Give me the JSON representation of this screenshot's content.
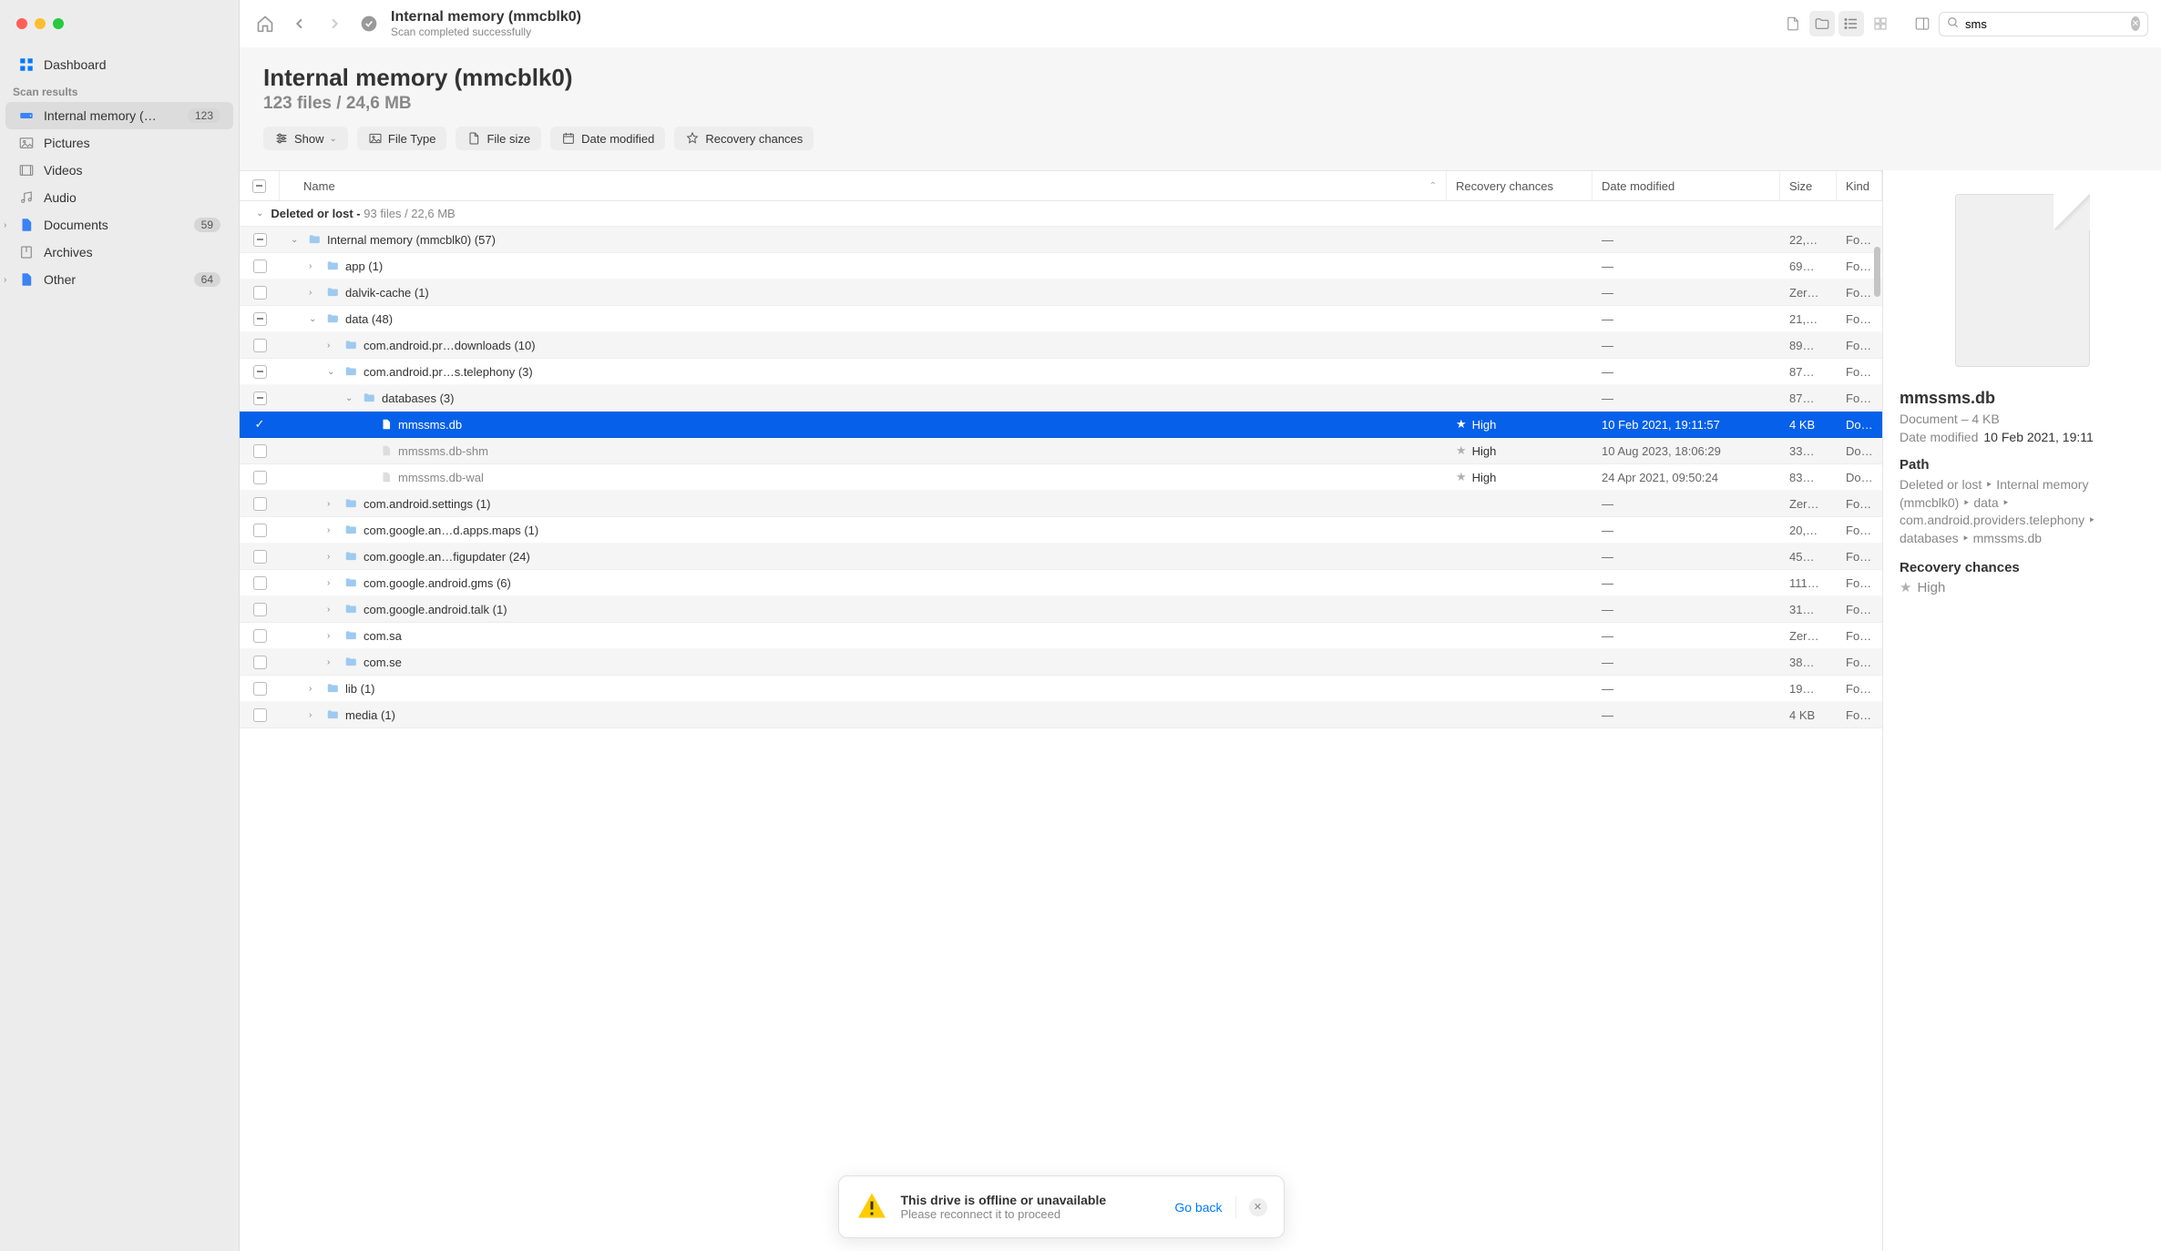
{
  "sidebar": {
    "dashboard": "Dashboard",
    "section": "Scan results",
    "items": [
      {
        "label": "Internal memory (…",
        "badge": "123",
        "active": true,
        "icon": "drive",
        "chev": false
      },
      {
        "label": "Pictures",
        "icon": "image",
        "chev": false
      },
      {
        "label": "Videos",
        "icon": "video",
        "chev": false
      },
      {
        "label": "Audio",
        "icon": "audio",
        "chev": false
      },
      {
        "label": "Documents",
        "badge": "59",
        "icon": "doc",
        "chev": true
      },
      {
        "label": "Archives",
        "icon": "archive",
        "chev": false
      },
      {
        "label": "Other",
        "badge": "64",
        "icon": "other",
        "chev": true
      }
    ]
  },
  "toolbar": {
    "title": "Internal memory (mmcblk0)",
    "subtitle": "Scan completed successfully",
    "search_value": "sms"
  },
  "header": {
    "title": "Internal memory (mmcblk0)",
    "subtitle": "123 files / 24,6 MB"
  },
  "filters": {
    "show": "Show",
    "filetype": "File Type",
    "filesize": "File size",
    "datemod": "Date modified",
    "recovery": "Recovery chances"
  },
  "columns": {
    "name": "Name",
    "recovery": "Recovery chances",
    "date": "Date modified",
    "size": "Size",
    "kind": "Kind"
  },
  "group": {
    "label": "Deleted or lost -",
    "meta": "93 files / 22,6 MB"
  },
  "rows": [
    {
      "indent": 0,
      "chev": "down",
      "cb": "part",
      "icon": "folder",
      "name": "Internal memory (mmcblk0) (57)",
      "rec": "",
      "date": "—",
      "size": "22,…",
      "kind": "Fol…"
    },
    {
      "indent": 1,
      "chev": "right",
      "cb": "",
      "icon": "folder",
      "name": "app (1)",
      "rec": "",
      "date": "—",
      "size": "69…",
      "kind": "Fol…"
    },
    {
      "indent": 1,
      "chev": "right",
      "cb": "",
      "icon": "folder",
      "name": "dalvik-cache (1)",
      "rec": "",
      "date": "—",
      "size": "Zer…",
      "kind": "Fol…"
    },
    {
      "indent": 1,
      "chev": "down",
      "cb": "part",
      "icon": "folder",
      "name": "data (48)",
      "rec": "",
      "date": "—",
      "size": "21,…",
      "kind": "Fol…"
    },
    {
      "indent": 2,
      "chev": "right",
      "cb": "",
      "icon": "folder",
      "name": "com.android.pr…downloads (10)",
      "rec": "",
      "date": "—",
      "size": "89…",
      "kind": "Fol…"
    },
    {
      "indent": 2,
      "chev": "down",
      "cb": "part",
      "icon": "folder",
      "name": "com.android.pr…s.telephony (3)",
      "rec": "",
      "date": "—",
      "size": "87…",
      "kind": "Fol…"
    },
    {
      "indent": 3,
      "chev": "down",
      "cb": "part",
      "icon": "folder",
      "name": "databases (3)",
      "rec": "",
      "date": "—",
      "size": "87…",
      "kind": "Fol…"
    },
    {
      "indent": 4,
      "chev": "",
      "cb": "checked",
      "icon": "file",
      "name": "mmssms.db",
      "rec": "High",
      "date": "10 Feb 2021, 19:11:57",
      "size": "4 KB",
      "kind": "Do…",
      "selected": true
    },
    {
      "indent": 4,
      "chev": "",
      "cb": "",
      "icon": "filegrey",
      "name": "mmssms.db-shm",
      "rec": "High",
      "date": "10 Aug 2023, 18:06:29",
      "size": "33…",
      "kind": "Do…",
      "grey": true
    },
    {
      "indent": 4,
      "chev": "",
      "cb": "",
      "icon": "filegrey",
      "name": "mmssms.db-wal",
      "rec": "High",
      "date": "24 Apr 2021, 09:50:24",
      "size": "83…",
      "kind": "Do…",
      "grey": true
    },
    {
      "indent": 2,
      "chev": "right",
      "cb": "",
      "icon": "folder",
      "name": "com.android.settings (1)",
      "rec": "",
      "date": "—",
      "size": "Zer…",
      "kind": "Fol…"
    },
    {
      "indent": 2,
      "chev": "right",
      "cb": "",
      "icon": "folder",
      "name": "com.google.an…d.apps.maps (1)",
      "rec": "",
      "date": "—",
      "size": "20,…",
      "kind": "Fol…"
    },
    {
      "indent": 2,
      "chev": "right",
      "cb": "",
      "icon": "folder",
      "name": "com.google.an…figupdater (24)",
      "rec": "",
      "date": "—",
      "size": "45…",
      "kind": "Fol…"
    },
    {
      "indent": 2,
      "chev": "right",
      "cb": "",
      "icon": "folder",
      "name": "com.google.android.gms (6)",
      "rec": "",
      "date": "—",
      "size": "111…",
      "kind": "Fol…"
    },
    {
      "indent": 2,
      "chev": "right",
      "cb": "",
      "icon": "folder",
      "name": "com.google.android.talk (1)",
      "rec": "",
      "date": "—",
      "size": "31…",
      "kind": "Fol…"
    },
    {
      "indent": 2,
      "chev": "right",
      "cb": "",
      "icon": "folder",
      "name": "com.sa",
      "rec": "",
      "date": "—",
      "size": "Zer…",
      "kind": "Fol…"
    },
    {
      "indent": 2,
      "chev": "right",
      "cb": "",
      "icon": "folder",
      "name": "com.se",
      "rec": "",
      "date": "—",
      "size": "38…",
      "kind": "Fol…"
    },
    {
      "indent": 1,
      "chev": "right",
      "cb": "",
      "icon": "folder",
      "name": "lib (1)",
      "rec": "",
      "date": "—",
      "size": "19…",
      "kind": "Fol…"
    },
    {
      "indent": 1,
      "chev": "right",
      "cb": "",
      "icon": "folder",
      "name": "media (1)",
      "rec": "",
      "date": "—",
      "size": "4 KB",
      "kind": "Fol…"
    }
  ],
  "detail": {
    "title": "mmssms.db",
    "doctype": "Document – 4 KB",
    "mod_k": "Date modified",
    "mod_v": "10 Feb 2021, 19:11",
    "path_k": "Path",
    "path_v": "Deleted or lost ‣ Internal memory (mmcblk0) ‣ data ‣ com.android.providers.telephony ‣ databases ‣ mmssms.db",
    "rec_k": "Recovery chances",
    "rec_v": "High"
  },
  "toast": {
    "title": "This drive is offline or unavailable",
    "sub": "Please reconnect it to proceed",
    "link": "Go back"
  }
}
